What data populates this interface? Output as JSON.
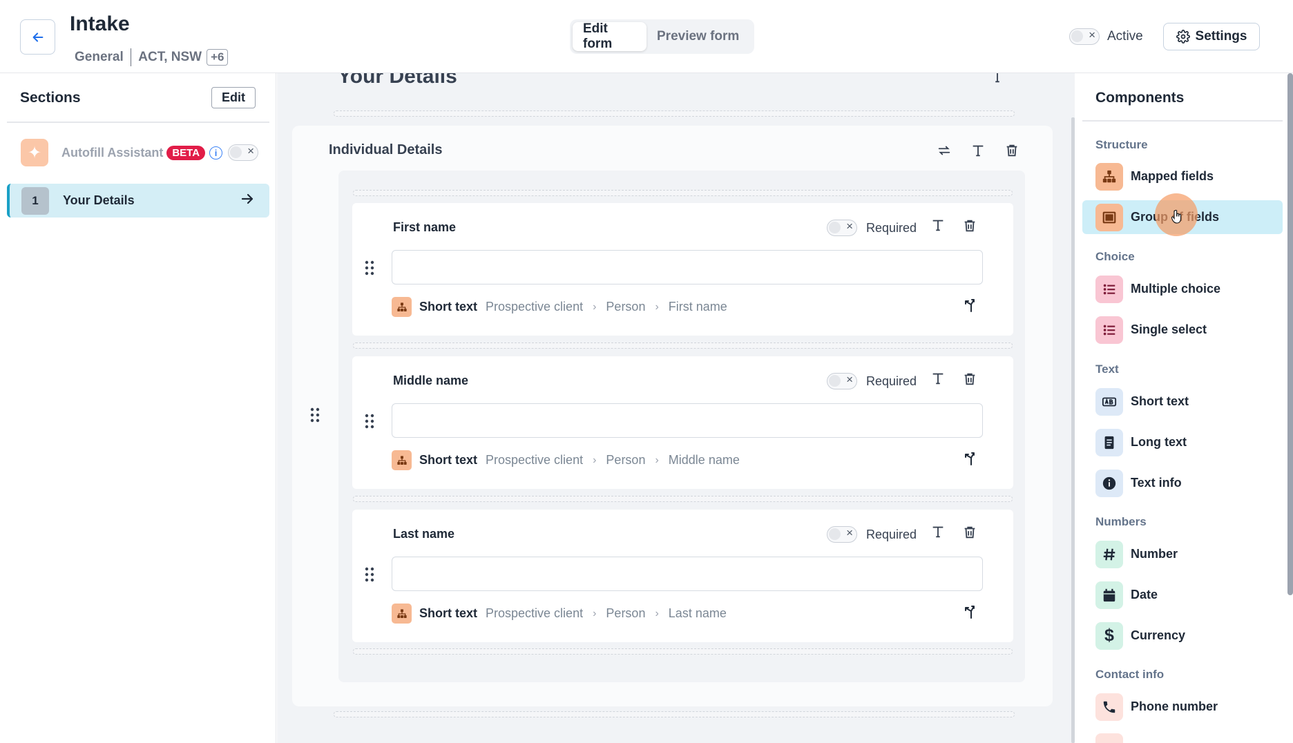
{
  "header": {
    "title": "Intake",
    "category": "General",
    "jurisdictions": "ACT, NSW",
    "more_count": "+6",
    "tabs": [
      {
        "label": "Edit form",
        "active": true
      },
      {
        "label": "Preview form",
        "active": false
      }
    ],
    "active_label": "Active",
    "settings_label": "Settings"
  },
  "sidebar": {
    "title": "Sections",
    "edit_label": "Edit",
    "autofill_label": "Autofill Assistant",
    "beta_label": "BETA",
    "sections": [
      {
        "number": "1",
        "label": "Your Details"
      }
    ]
  },
  "main": {
    "page_heading": "Your Details",
    "group_title": "Individual Details",
    "fields": [
      {
        "label": "First name",
        "required_label": "Required",
        "type": "Short text",
        "path": [
          "Prospective client",
          "Person",
          "First name"
        ]
      },
      {
        "label": "Middle name",
        "required_label": "Required",
        "type": "Short text",
        "path": [
          "Prospective client",
          "Person",
          "Middle name"
        ]
      },
      {
        "label": "Last name",
        "required_label": "Required",
        "type": "Short text",
        "path": [
          "Prospective client",
          "Person",
          "Last name"
        ]
      }
    ]
  },
  "components": {
    "title": "Components",
    "categories": [
      {
        "name": "Structure",
        "items": [
          {
            "label": "Mapped fields",
            "icon": "mapped-fields-icon"
          },
          {
            "label": "Group of fields",
            "icon": "group-icon",
            "highlighted": true
          }
        ]
      },
      {
        "name": "Choice",
        "items": [
          {
            "label": "Multiple choice",
            "icon": "list-icon"
          },
          {
            "label": "Single select",
            "icon": "list-icon"
          }
        ]
      },
      {
        "name": "Text",
        "items": [
          {
            "label": "Short text",
            "icon": "short-text-icon"
          },
          {
            "label": "Long text",
            "icon": "long-text-icon"
          },
          {
            "label": "Text info",
            "icon": "info-icon"
          }
        ]
      },
      {
        "name": "Numbers",
        "items": [
          {
            "label": "Number",
            "icon": "hash-icon"
          },
          {
            "label": "Date",
            "icon": "calendar-icon"
          },
          {
            "label": "Currency",
            "icon": "dollar-icon"
          }
        ]
      },
      {
        "name": "Contact info",
        "items": [
          {
            "label": "Phone number",
            "icon": "phone-icon"
          }
        ]
      }
    ]
  },
  "colors": {
    "accent": "#1aa0c6",
    "highlight": "#cdeef8",
    "beta": "#e11d48",
    "orange_icon": "#f7b993"
  }
}
